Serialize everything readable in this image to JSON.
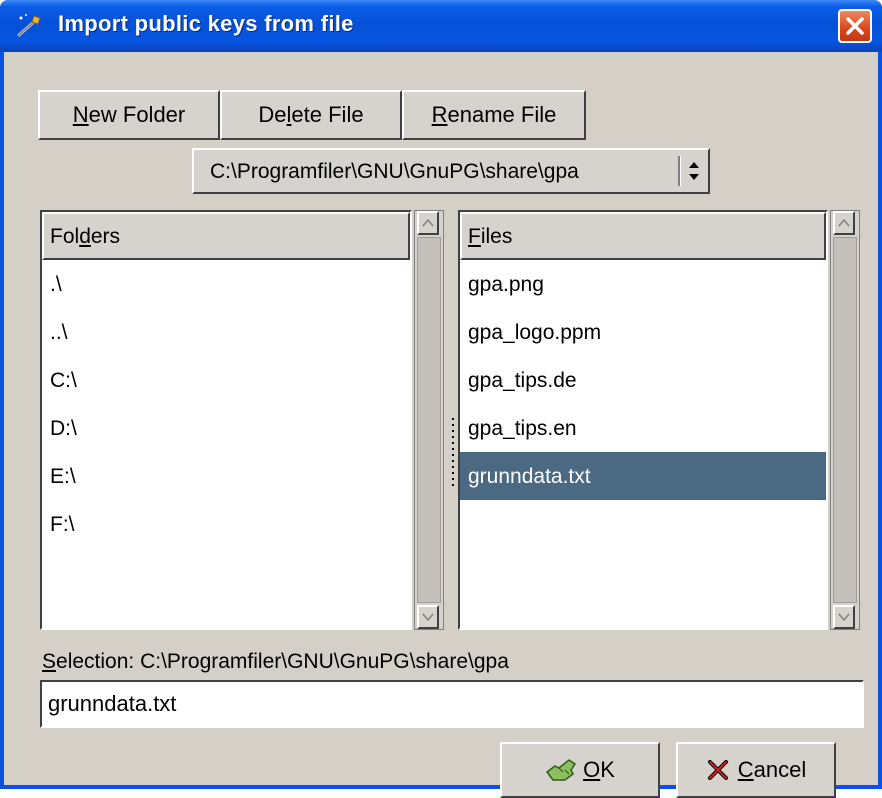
{
  "window": {
    "title": "Import public keys from file",
    "title_icon": "key-wand-icon",
    "close_icon": "close-icon"
  },
  "toolbar": {
    "new_folder": {
      "pre": "",
      "accel": "N",
      "post": "ew Folder"
    },
    "delete_file": {
      "pre": "De",
      "accel": "l",
      "post": "ete File"
    },
    "rename_file": {
      "pre": "",
      "accel": "R",
      "post": "ename File"
    }
  },
  "path_combo": {
    "value": "C:\\Programfiler\\GNU\\GnuPG\\share\\gpa",
    "icon": "updown-arrows-icon"
  },
  "folders": {
    "header": {
      "pre": "Fol",
      "accel": "d",
      "post": "ers"
    },
    "items": [
      ".\\",
      "..\\",
      "C:\\",
      "D:\\",
      "E:\\",
      "F:\\"
    ]
  },
  "files": {
    "header": {
      "pre": "",
      "accel": "F",
      "post": "iles"
    },
    "items": [
      "gpa.png",
      "gpa_logo.ppm",
      "gpa_tips.de",
      "gpa_tips.en",
      "grunndata.txt"
    ],
    "selected_index": 4
  },
  "selection": {
    "label": {
      "pre": "",
      "accel": "S",
      "post": "election:  C:\\Programfiler\\GNU\\GnuPG\\share\\gpa"
    },
    "value": "grunndata.txt"
  },
  "buttons": {
    "ok": {
      "accel": "O",
      "post": "K",
      "icon": "ok-hand-icon"
    },
    "cancel": {
      "accel": "C",
      "post": "ancel",
      "icon": "cancel-x-icon"
    }
  },
  "colors": {
    "selection_bg": "#4b6983",
    "dialog_bg": "#d4d0c8",
    "titlebar": "#0551d8",
    "close_button": "#d9461e"
  }
}
